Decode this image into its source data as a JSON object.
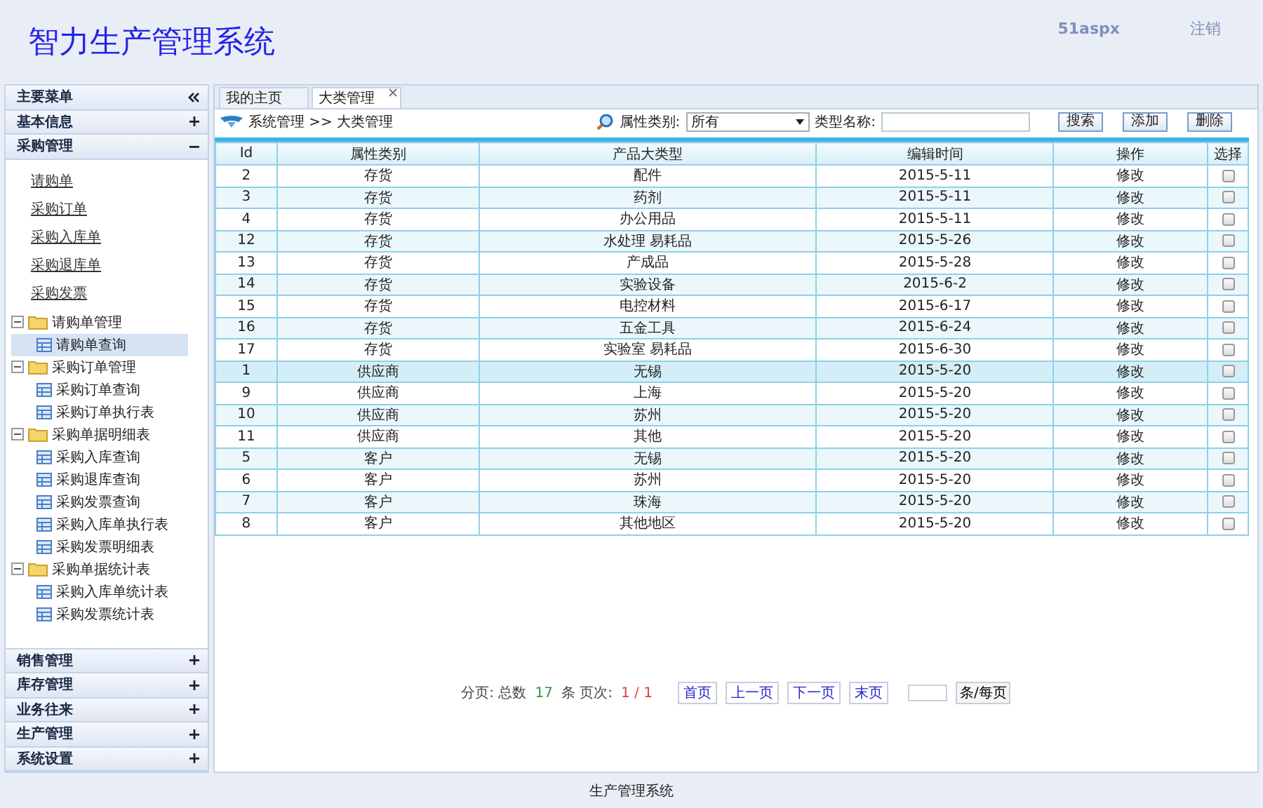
{
  "header": {
    "title": "智力生产管理系统",
    "site_label": "51aspx",
    "logout": "注销"
  },
  "sidebar": {
    "title": "主要菜单",
    "sections": [
      {
        "label": "基本信息",
        "expanded": false
      },
      {
        "label": "采购管理",
        "expanded": true,
        "links": [
          "请购单",
          "采购订单",
          "采购入库单",
          "采购退库单",
          "采购发票"
        ],
        "tree": [
          {
            "label": "请购单管理",
            "expanded": true,
            "children": [
              {
                "label": "请购单查询",
                "selected": true
              }
            ]
          },
          {
            "label": "采购订单管理",
            "expanded": true,
            "children": [
              {
                "label": "采购订单查询",
                "selected": false
              },
              {
                "label": "采购订单执行表",
                "selected": false
              }
            ]
          },
          {
            "label": "采购单据明细表",
            "expanded": true,
            "children": [
              {
                "label": "采购入库查询",
                "selected": false
              },
              {
                "label": "采购退库查询",
                "selected": false
              },
              {
                "label": "采购发票查询",
                "selected": false
              },
              {
                "label": "采购入库单执行表",
                "selected": false
              },
              {
                "label": "采购发票明细表",
                "selected": false
              }
            ]
          },
          {
            "label": "采购单据统计表",
            "expanded": true,
            "children": [
              {
                "label": "采购入库单统计表",
                "selected": false
              },
              {
                "label": "采购发票统计表",
                "selected": false
              }
            ]
          }
        ]
      },
      {
        "label": "销售管理",
        "expanded": false
      },
      {
        "label": "库存管理",
        "expanded": false
      },
      {
        "label": "业务往来",
        "expanded": false
      },
      {
        "label": "生产管理",
        "expanded": false
      },
      {
        "label": "系统设置",
        "expanded": false
      }
    ]
  },
  "tabs": [
    {
      "label": "我的主页",
      "selected": false,
      "closable": false
    },
    {
      "label": "大类管理",
      "selected": true,
      "closable": true
    }
  ],
  "toolbar": {
    "breadcrumb": "系统管理 >> 大类管理",
    "filter_label": "属性类别:",
    "filter_value": "所有",
    "name_label": "类型名称:",
    "buttons": [
      "搜索",
      "添加",
      "删除"
    ]
  },
  "table": {
    "columns": [
      "Id",
      "属性类别",
      "产品大类型",
      "编辑时间",
      "操作",
      "选择"
    ],
    "rows": [
      {
        "cells": [
          "2",
          "存货",
          "配件",
          "2015-5-11",
          "修改"
        ],
        "checked": false,
        "selected": false
      },
      {
        "cells": [
          "3",
          "存货",
          "药剂",
          "2015-5-11",
          "修改"
        ],
        "checked": false,
        "selected": false
      },
      {
        "cells": [
          "4",
          "存货",
          "办公用品",
          "2015-5-11",
          "修改"
        ],
        "checked": false,
        "selected": false
      },
      {
        "cells": [
          "12",
          "存货",
          "水处理 易耗品",
          "2015-5-26",
          "修改"
        ],
        "checked": false,
        "selected": false
      },
      {
        "cells": [
          "13",
          "存货",
          "产成品",
          "2015-5-28",
          "修改"
        ],
        "checked": false,
        "selected": false
      },
      {
        "cells": [
          "14",
          "存货",
          "实验设备",
          "2015-6-2",
          "修改"
        ],
        "checked": false,
        "selected": false
      },
      {
        "cells": [
          "15",
          "存货",
          "电控材料",
          "2015-6-17",
          "修改"
        ],
        "checked": false,
        "selected": false
      },
      {
        "cells": [
          "16",
          "存货",
          "五金工具",
          "2015-6-24",
          "修改"
        ],
        "checked": false,
        "selected": false
      },
      {
        "cells": [
          "17",
          "存货",
          "实验室 易耗品",
          "2015-6-30",
          "修改"
        ],
        "checked": false,
        "selected": false
      },
      {
        "cells": [
          "1",
          "供应商",
          "无锡",
          "2015-5-20",
          "修改"
        ],
        "checked": false,
        "selected": true
      },
      {
        "cells": [
          "9",
          "供应商",
          "上海",
          "2015-5-20",
          "修改"
        ],
        "checked": false,
        "selected": false
      },
      {
        "cells": [
          "10",
          "供应商",
          "苏州",
          "2015-5-20",
          "修改"
        ],
        "checked": false,
        "selected": false
      },
      {
        "cells": [
          "11",
          "供应商",
          "其他",
          "2015-5-20",
          "修改"
        ],
        "checked": false,
        "selected": false
      },
      {
        "cells": [
          "5",
          "客户",
          "无锡",
          "2015-5-20",
          "修改"
        ],
        "checked": false,
        "selected": false
      },
      {
        "cells": [
          "6",
          "客户",
          "苏州",
          "2015-5-20",
          "修改"
        ],
        "checked": false,
        "selected": false
      },
      {
        "cells": [
          "7",
          "客户",
          "珠海",
          "2015-5-20",
          "修改"
        ],
        "checked": false,
        "selected": false
      },
      {
        "cells": [
          "8",
          "客户",
          "其他地区",
          "2015-5-20",
          "修改"
        ],
        "checked": false,
        "selected": false
      }
    ]
  },
  "pager": {
    "label": "分页: 总数",
    "total": "17",
    "unit": "条 页次:",
    "page": "1 / 1",
    "links": [
      "首页",
      "上一页",
      "下一页",
      "末页"
    ],
    "per_page_button": "条/每页"
  },
  "footer": "生产管理系统"
}
